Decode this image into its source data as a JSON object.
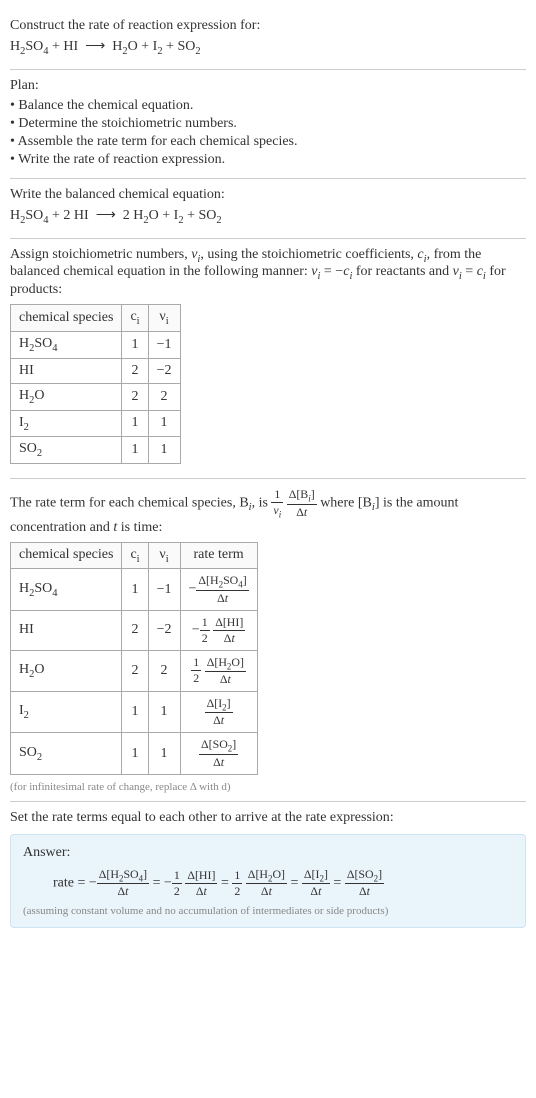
{
  "intro": {
    "line1": "Construct the rate of reaction expression for:",
    "equation_html": "H<sub>2</sub>SO<sub>4</sub> + HI &nbsp;⟶&nbsp; H<sub>2</sub>O + I<sub>2</sub> + SO<sub>2</sub>"
  },
  "plan": {
    "title": "Plan:",
    "bullets": [
      "• Balance the chemical equation.",
      "• Determine the stoichiometric numbers.",
      "• Assemble the rate term for each chemical species.",
      "• Write the rate of reaction expression."
    ]
  },
  "balanced": {
    "text": "Write the balanced chemical equation:",
    "equation_html": "H<sub>2</sub>SO<sub>4</sub> + 2 HI &nbsp;⟶&nbsp; 2 H<sub>2</sub>O + I<sub>2</sub> + SO<sub>2</sub>"
  },
  "assign": {
    "text_html": "Assign stoichiometric numbers, <span class='ital'>ν<sub>i</sub></span>, using the stoichiometric coefficients, <span class='ital'>c<sub>i</sub></span>, from the balanced chemical equation in the following manner: <span class='ital'>ν<sub>i</sub></span> = −<span class='ital'>c<sub>i</sub></span> for reactants and <span class='ital'>ν<sub>i</sub></span> = <span class='ital'>c<sub>i</sub></span> for products:"
  },
  "table1": {
    "headers": [
      "chemical species",
      "c<sub>i</sub>",
      "ν<sub>i</sub>"
    ],
    "rows": [
      [
        "H<sub>2</sub>SO<sub>4</sub>",
        "1",
        "−1"
      ],
      [
        "HI",
        "2",
        "−2"
      ],
      [
        "H<sub>2</sub>O",
        "2",
        "2"
      ],
      [
        "I<sub>2</sub>",
        "1",
        "1"
      ],
      [
        "SO<sub>2</sub>",
        "1",
        "1"
      ]
    ]
  },
  "rate_term_text_html": "The rate term for each chemical species, B<sub><span class='ital'>i</span></sub>, is <span class='frac'><span class='num'>1</span><span class='den'><span class='ital'>ν<sub>i</sub></span></span></span> <span class='frac'><span class='num'>Δ[B<sub><span class='ital'>i</span></sub>]</span><span class='den'>Δ<span class='ital'>t</span></span></span> where [B<sub><span class='ital'>i</span></sub>] is the amount concentration and <span class='ital'>t</span> is time:",
  "table2": {
    "headers": [
      "chemical species",
      "c<sub>i</sub>",
      "ν<sub>i</sub>",
      "rate term"
    ],
    "rows": [
      [
        "H<sub>2</sub>SO<sub>4</sub>",
        "1",
        "−1",
        "−<span class='frac'><span class='num'>Δ[H<sub>2</sub>SO<sub>4</sub>]</span><span class='den'>Δ<span class='ital'>t</span></span></span>"
      ],
      [
        "HI",
        "2",
        "−2",
        "−<span class='frac'><span class='num'>1</span><span class='den'>2</span></span> <span class='frac'><span class='num'>Δ[HI]</span><span class='den'>Δ<span class='ital'>t</span></span></span>"
      ],
      [
        "H<sub>2</sub>O",
        "2",
        "2",
        "<span class='frac'><span class='num'>1</span><span class='den'>2</span></span> <span class='frac'><span class='num'>Δ[H<sub>2</sub>O]</span><span class='den'>Δ<span class='ital'>t</span></span></span>"
      ],
      [
        "I<sub>2</sub>",
        "1",
        "1",
        "<span class='frac'><span class='num'>Δ[I<sub>2</sub>]</span><span class='den'>Δ<span class='ital'>t</span></span></span>"
      ],
      [
        "SO<sub>2</sub>",
        "1",
        "1",
        "<span class='frac'><span class='num'>Δ[SO<sub>2</sub>]</span><span class='den'>Δ<span class='ital'>t</span></span></span>"
      ]
    ]
  },
  "infinitesimal_note": "(for infinitesimal rate of change, replace Δ with d)",
  "set_equal_text": "Set the rate terms equal to each other to arrive at the rate expression:",
  "answer": {
    "title": "Answer:",
    "rate_html": "rate = −<span class='frac'><span class='num'>Δ[H<sub>2</sub>SO<sub>4</sub>]</span><span class='den'>Δ<span class='ital'>t</span></span></span> = −<span class='frac'><span class='num'>1</span><span class='den'>2</span></span> <span class='frac'><span class='num'>Δ[HI]</span><span class='den'>Δ<span class='ital'>t</span></span></span> = <span class='frac'><span class='num'>1</span><span class='den'>2</span></span> <span class='frac'><span class='num'>Δ[H<sub>2</sub>O]</span><span class='den'>Δ<span class='ital'>t</span></span></span> = <span class='frac'><span class='num'>Δ[I<sub>2</sub>]</span><span class='den'>Δ<span class='ital'>t</span></span></span> = <span class='frac'><span class='num'>Δ[SO<sub>2</sub>]</span><span class='den'>Δ<span class='ital'>t</span></span></span>",
    "note": "(assuming constant volume and no accumulation of intermediates or side products)"
  },
  "chart_data": {
    "type": "table",
    "tables": [
      {
        "title": "Stoichiometric numbers",
        "columns": [
          "chemical species",
          "c_i",
          "ν_i"
        ],
        "rows": [
          {
            "chemical species": "H2SO4",
            "c_i": 1,
            "ν_i": -1
          },
          {
            "chemical species": "HI",
            "c_i": 2,
            "ν_i": -2
          },
          {
            "chemical species": "H2O",
            "c_i": 2,
            "ν_i": 2
          },
          {
            "chemical species": "I2",
            "c_i": 1,
            "ν_i": 1
          },
          {
            "chemical species": "SO2",
            "c_i": 1,
            "ν_i": 1
          }
        ]
      },
      {
        "title": "Rate terms",
        "columns": [
          "chemical species",
          "c_i",
          "ν_i",
          "rate term"
        ],
        "rows": [
          {
            "chemical species": "H2SO4",
            "c_i": 1,
            "ν_i": -1,
            "rate term": "-Δ[H2SO4]/Δt"
          },
          {
            "chemical species": "HI",
            "c_i": 2,
            "ν_i": -2,
            "rate term": "-(1/2) Δ[HI]/Δt"
          },
          {
            "chemical species": "H2O",
            "c_i": 2,
            "ν_i": 2,
            "rate term": "(1/2) Δ[H2O]/Δt"
          },
          {
            "chemical species": "I2",
            "c_i": 1,
            "ν_i": 1,
            "rate term": "Δ[I2]/Δt"
          },
          {
            "chemical species": "SO2",
            "c_i": 1,
            "ν_i": 1,
            "rate term": "Δ[SO2]/Δt"
          }
        ]
      }
    ]
  }
}
